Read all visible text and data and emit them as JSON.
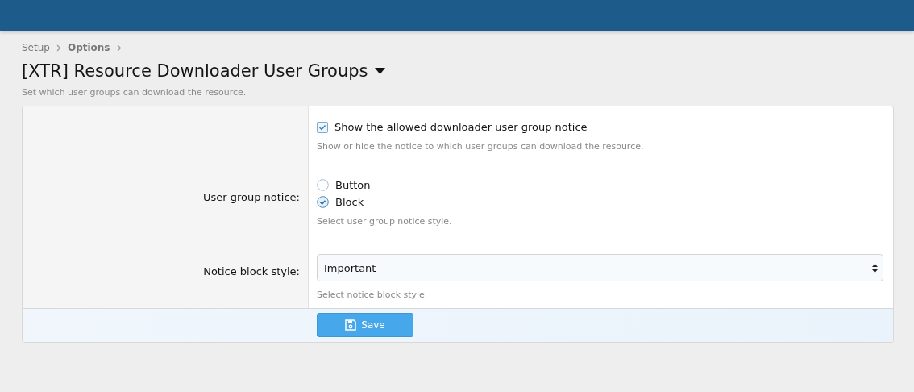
{
  "breadcrumb": [
    {
      "label": "Setup",
      "current": false
    },
    {
      "label": "Options",
      "current": true
    }
  ],
  "title": "[XTR] Resource Downloader User Groups",
  "description": "Set which user groups can download the resource.",
  "rows": [
    {
      "kind": "checkbox",
      "option": "Show the allowed downloader user group notice",
      "checked": true,
      "hint": "Show or hide the notice to which user groups can download the resource."
    },
    {
      "kind": "radio",
      "label": "User group notice:",
      "options": [
        {
          "label": "Button",
          "selected": false
        },
        {
          "label": "Block",
          "selected": true
        }
      ],
      "hint": "Select user group notice style."
    },
    {
      "kind": "select",
      "label": "Notice block style:",
      "value": "Important",
      "hint": "Select notice block style."
    }
  ],
  "save_button": {
    "label": "Save"
  }
}
